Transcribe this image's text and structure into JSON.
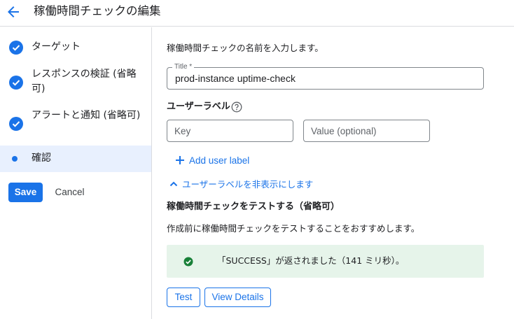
{
  "header": {
    "title": "稼働時間チェックの編集",
    "back_icon": "arrow-back-icon"
  },
  "sidebar": {
    "steps": [
      {
        "label": "ターゲット",
        "status": "complete",
        "icon": "check-circle-icon"
      },
      {
        "label": "レスポンスの検証 (省略可)",
        "status": "complete",
        "icon": "check-circle-icon"
      },
      {
        "label": "アラートと通知 (省略可)",
        "status": "complete",
        "icon": "check-circle-icon"
      },
      {
        "label": "確認",
        "status": "current",
        "icon": "dot-icon"
      }
    ],
    "save_label": "Save",
    "cancel_label": "Cancel"
  },
  "main": {
    "intro": "稼働時間チェックの名前を入力します。",
    "title_field": {
      "label": "Title *",
      "value": "prod-instance uptime-check"
    },
    "user_labels": {
      "heading": "ユーザーラベル",
      "help_icon": "help-circle-icon",
      "key_placeholder": "Key",
      "value_placeholder": "Value (optional)",
      "add_label": "Add user label",
      "hide_label": "ユーザーラベルを非表示にします"
    },
    "test": {
      "heading": "稼働時間チェックをテストする（省略可）",
      "description": "作成前に稼働時間チェックをテストすることをおすすめします。",
      "result_text": "「SUCCESS」が返されました（141 ミリ秒）。",
      "result_icon": "check-circle-icon",
      "test_button": "Test",
      "details_button": "View Details"
    }
  },
  "colors": {
    "accent": "#1a73e8",
    "success": "#188038",
    "success_bg": "#e6f4ea",
    "active_step_bg": "#e8f0fe"
  }
}
